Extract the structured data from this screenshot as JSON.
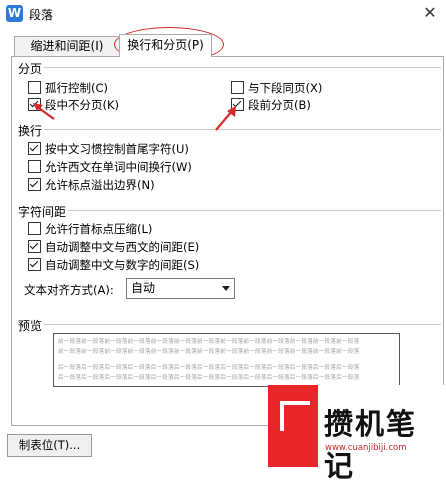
{
  "window": {
    "title": "段落",
    "app_icon": "W"
  },
  "tabs": [
    {
      "label": "缩进和间距(I)",
      "active": false
    },
    {
      "label": "换行和分页(P)",
      "active": true
    }
  ],
  "pagination": {
    "heading": "分页",
    "items": [
      {
        "label": "孤行控制(C)",
        "checked": false
      },
      {
        "label": "与下段同页(X)",
        "checked": false
      },
      {
        "label": "段中不分页(K)",
        "checked": true
      },
      {
        "label": "段前分页(B)",
        "checked": true
      }
    ]
  },
  "line_break": {
    "heading": "换行",
    "items": [
      {
        "label": "按中文习惯控制首尾字符(U)",
        "checked": true
      },
      {
        "label": "允许西文在单词中间换行(W)",
        "checked": false
      },
      {
        "label": "允许标点溢出边界(N)",
        "checked": true
      }
    ]
  },
  "char_spacing": {
    "heading": "字符间距",
    "items": [
      {
        "label": "允许行首标点压缩(L)",
        "checked": false
      },
      {
        "label": "自动调整中文与西文的间距(E)",
        "checked": true
      },
      {
        "label": "自动调整中文与数字的间距(S)",
        "checked": true
      }
    ],
    "align_label": "文本对齐方式(A):",
    "align_value": "自动"
  },
  "preview": {
    "heading": "预览",
    "lines": [
      "前一段落前一段落前一段落前一段落前一段落前一段落前一段落前一段落前一段落前一段落前一段落前一段落前一段落",
      "前一段落前一段落前一段落前一段落前一段落前一段落前一段落前一段落前一段落前一段落前一段落前一段落前一段落",
      "后一段落后一段落后一段落后一段落后一段落后一段落后一段落后一段落后一段落后一段落后一段落后一段落后一段落",
      "后一段落后一段落后一段落后一段落后一段落后一段落后一段落后一段落后一段落后一段落后一段落后一段落后一段落"
    ]
  },
  "buttons": {
    "tabs": "制表位(T)..."
  },
  "watermark": {
    "text": "攒机笔记",
    "url": "www.cuanjibiji.com"
  },
  "colors": {
    "annotation_red": "#d62828",
    "watermark_red": "#e8262a",
    "icon_blue": "#2e7bd6"
  }
}
